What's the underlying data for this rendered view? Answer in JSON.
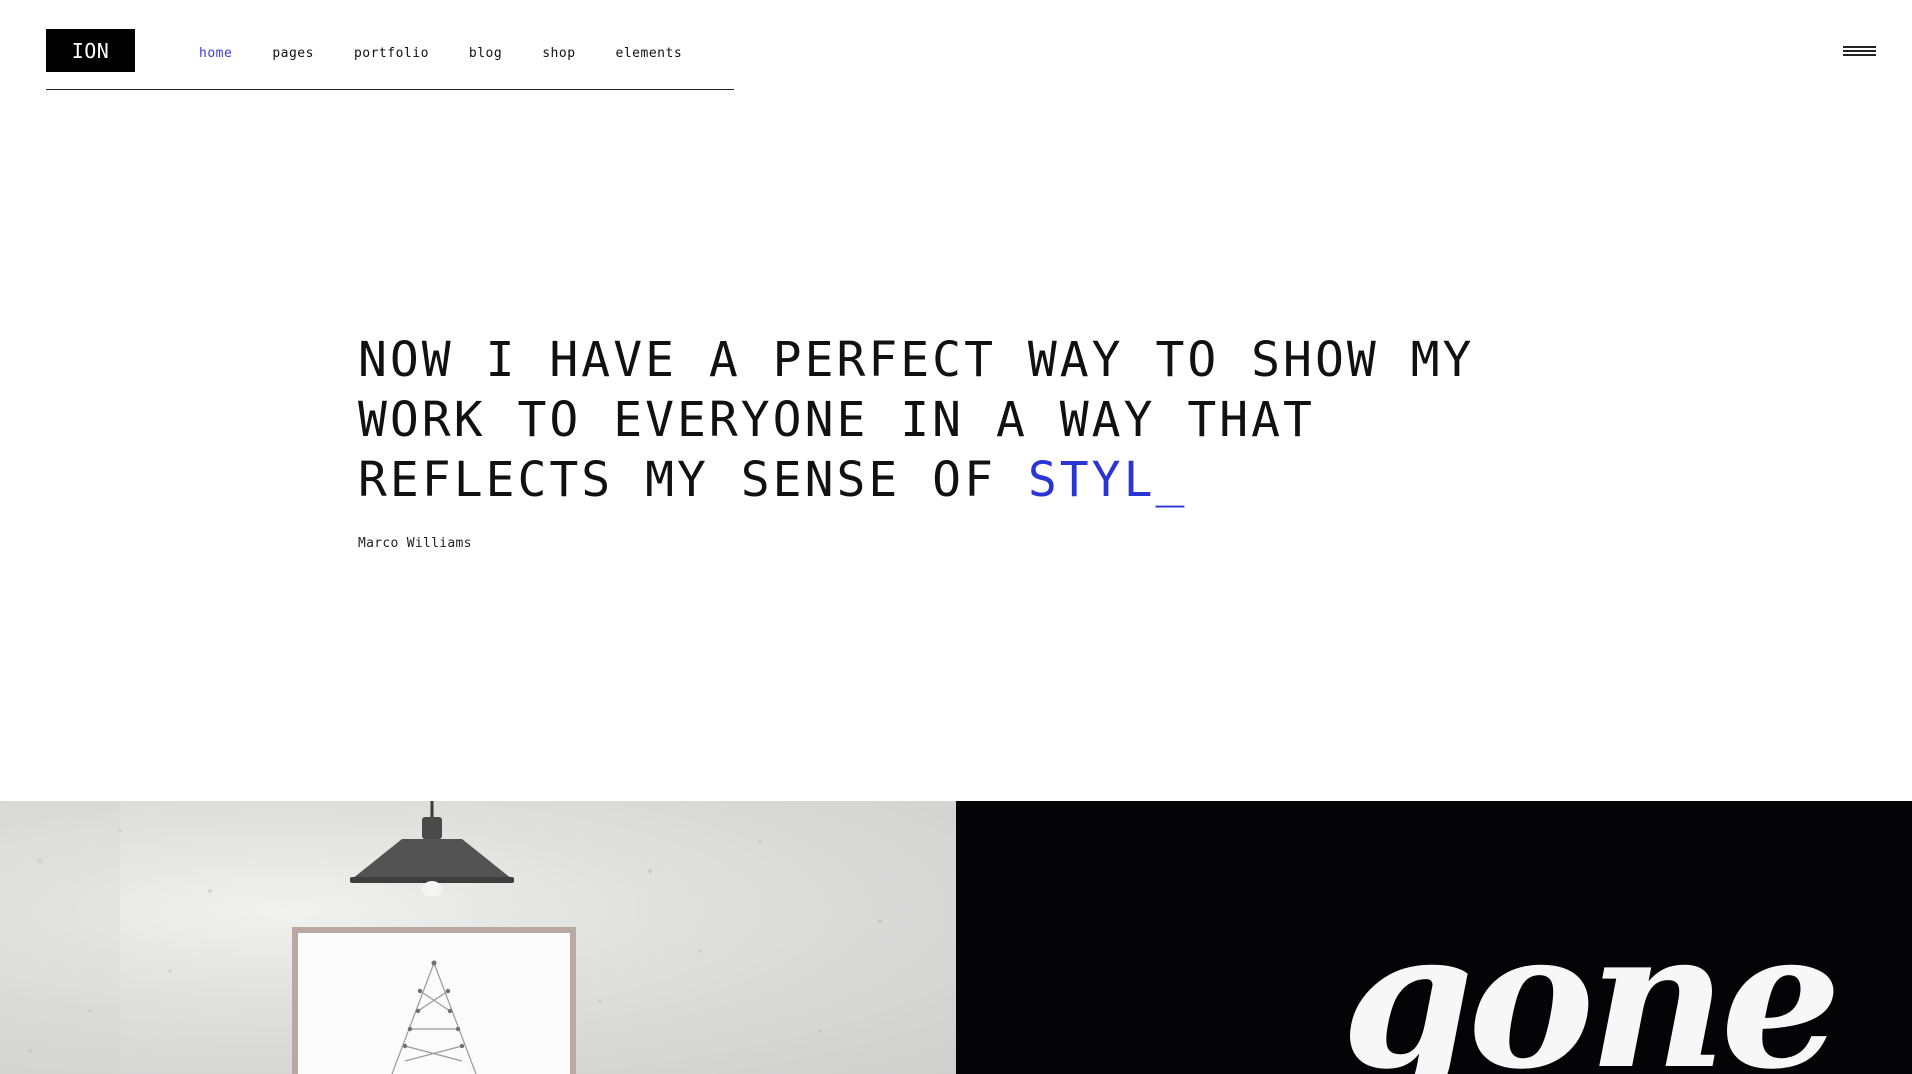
{
  "header": {
    "logo_text": "ION",
    "nav": [
      {
        "label": "home",
        "active": true
      },
      {
        "label": "pages",
        "active": false
      },
      {
        "label": "portfolio",
        "active": false
      },
      {
        "label": "blog",
        "active": false
      },
      {
        "label": "shop",
        "active": false
      },
      {
        "label": "elements",
        "active": false
      }
    ],
    "menu_icon": "hamburger-menu-icon"
  },
  "hero": {
    "line1": "NOW I HAVE A PERFECT WAY TO SHOW MY",
    "line2": "WORK TO EVERYONE IN A WAY THAT",
    "line3_prefix": "REFLECTS MY SENSE OF ",
    "line3_accent": "STYL_",
    "author": "Marco Williams"
  },
  "tiles": {
    "right_script_text": "gone"
  },
  "colors": {
    "accent": "#2b35d6",
    "nav_active": "#3b3bd8",
    "dark_tile": "#040406",
    "text": "#111111"
  }
}
